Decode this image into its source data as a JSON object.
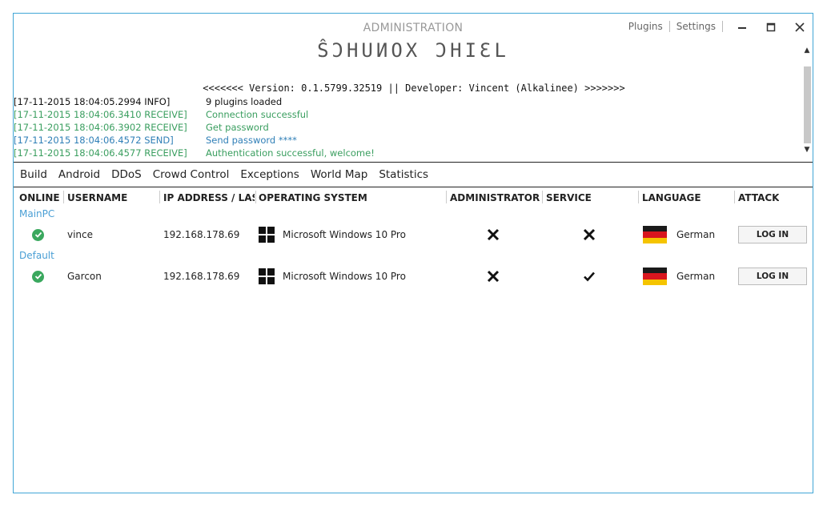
{
  "window": {
    "title": "ADMINISTRATION",
    "links": [
      "Plugins",
      "Settings"
    ],
    "banner": "ŜƆHUИOX ƆHIƐL",
    "version_line": "<<<<<<< Version: 0.1.5799.32519 || Developer: Vincent (Alkalinee) >>>>>>>"
  },
  "log": [
    {
      "ts": "[17-11-2015 18:04:05.2994 INFO]",
      "msg": "9 plugins loaded",
      "level": "info"
    },
    {
      "ts": "[17-11-2015 18:04:06.3410 RECEIVE]",
      "msg": "Connection successful",
      "level": "receive"
    },
    {
      "ts": "[17-11-2015 18:04:06.3902 RECEIVE]",
      "msg": "Get password",
      "level": "receive"
    },
    {
      "ts": "[17-11-2015 18:04:06.4572 SEND]",
      "msg": "Send password ****",
      "level": "send"
    },
    {
      "ts": "[17-11-2015 18:04:06.4577 RECEIVE]",
      "msg": "Authentication successful, welcome!",
      "level": "receive"
    }
  ],
  "menu": [
    "Build",
    "Android",
    "DDoS",
    "Crowd Control",
    "Exceptions",
    "World Map",
    "Statistics"
  ],
  "columns": [
    "ONLINE",
    "USERNAME",
    "IP ADDRESS / LAST S",
    "OPERATING SYSTEM",
    "ADMINISTRATOR",
    "SERVICE",
    "LANGUAGE",
    "ATTACK"
  ],
  "groups": [
    {
      "name": "MainPC",
      "clients": [
        {
          "username": "vince",
          "ip": "192.168.178.69",
          "os": "Microsoft Windows 10 Pro",
          "administrator": false,
          "service": false,
          "language": "German",
          "attack_label": "LOG IN"
        }
      ]
    },
    {
      "name": "Default",
      "clients": [
        {
          "username": "Garcon",
          "ip": "192.168.178.69",
          "os": "Microsoft Windows 10 Pro",
          "administrator": false,
          "service": true,
          "language": "German",
          "attack_label": "LOG IN"
        }
      ]
    }
  ],
  "colors": {
    "accent": "#41a6d6",
    "receive": "#3a9e5f",
    "send": "#2f7fb7",
    "online": "#3aa85e",
    "group": "#4a9fd5"
  }
}
